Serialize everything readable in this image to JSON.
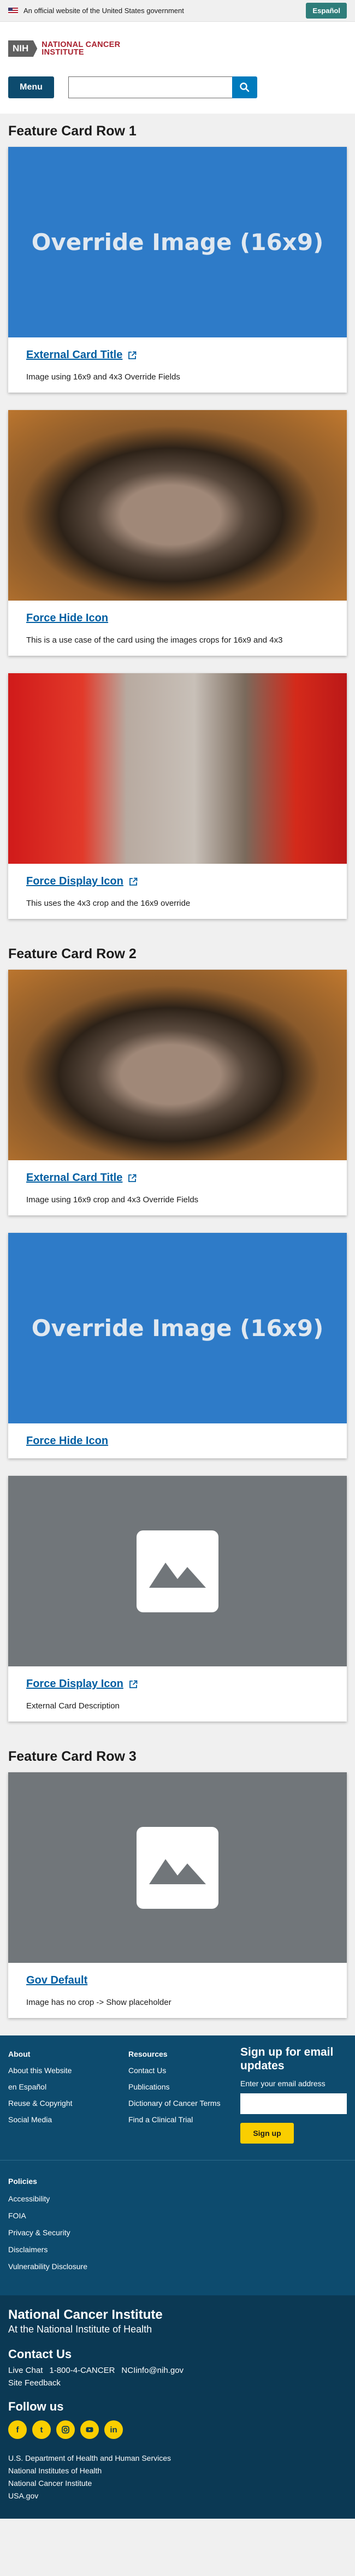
{
  "gov_banner": {
    "text": "An official website of the United States government",
    "lang_button": "Español"
  },
  "header": {
    "logo_badge": "NIH",
    "logo_line1": "NATIONAL CANCER",
    "logo_line2": "INSTITUTE",
    "menu_label": "Menu",
    "search_placeholder": ""
  },
  "rows": [
    {
      "title": "Feature Card Row 1",
      "cards": [
        {
          "image": "override",
          "image_text": "Override Image (16x9)",
          "title": "External Card Title",
          "external": true,
          "description": "Image using 16x9 and 4x3 Override Fields"
        },
        {
          "image": "kitten-a",
          "title": "Force Hide Icon",
          "external": false,
          "description": "This is a use case of the card using the images crops for 16x9 and 4x3"
        },
        {
          "image": "kitten-b",
          "title": "Force Display Icon",
          "external": true,
          "description": "This uses the 4x3 crop and the 16x9 override"
        }
      ]
    },
    {
      "title": "Feature Card Row 2",
      "cards": [
        {
          "image": "kitten-a",
          "title": "External Card Title",
          "external": true,
          "description": "Image using 16x9 crop and 4x3 Override Fields"
        },
        {
          "image": "override",
          "image_text": "Override Image (16x9)",
          "title": "Force Hide Icon",
          "external": false,
          "description": ""
        },
        {
          "image": "placeholder",
          "title": "Force Display Icon",
          "external": true,
          "description": "External Card Description"
        }
      ]
    },
    {
      "title": "Feature Card Row 3",
      "cards": [
        {
          "image": "placeholder",
          "title": "Gov Default",
          "external": false,
          "description": "Image has no crop -> Show placeholder"
        }
      ]
    }
  ],
  "footer": {
    "about": {
      "heading": "About",
      "links": [
        "About this Website",
        "en Español",
        "Reuse & Copyright",
        "Social Media"
      ]
    },
    "resources": {
      "heading": "Resources",
      "links": [
        "Contact Us",
        "Publications",
        "Dictionary of Cancer Terms",
        "Find a Clinical Trial"
      ]
    },
    "signup": {
      "heading": "Sign up for email updates",
      "label": "Enter your email address",
      "button": "Sign up"
    },
    "policies": {
      "heading": "Policies",
      "links": [
        "Accessibility",
        "FOIA",
        "Privacy & Security",
        "Disclaimers",
        "Vulnerability Disclosure"
      ]
    },
    "org_name": "National Cancer Institute",
    "org_sub": "At the National Institute of Health",
    "contact_heading": "Contact Us",
    "contact_live_chat": "Live Chat",
    "contact_phone": "1-800-4-CANCER",
    "contact_email": "NCIinfo@nih.gov",
    "site_feedback": "Site Feedback",
    "follow_heading": "Follow us",
    "social_icons": [
      "facebook-icon",
      "twitter-icon",
      "instagram-icon",
      "youtube-icon",
      "linkedin-icon"
    ],
    "agency_lines": [
      "U.S. Department of Health and Human Services",
      "National Institutes of Health",
      "National Cancer Institute",
      "USA.gov"
    ]
  },
  "colors": {
    "primary_blue": "#005ea2",
    "header_navy": "#0d4b6e",
    "footer_dark": "#0b3954",
    "accent_yellow": "#face00",
    "override_blue": "#2e7bc8",
    "placeholder_gray": "#71767a"
  }
}
